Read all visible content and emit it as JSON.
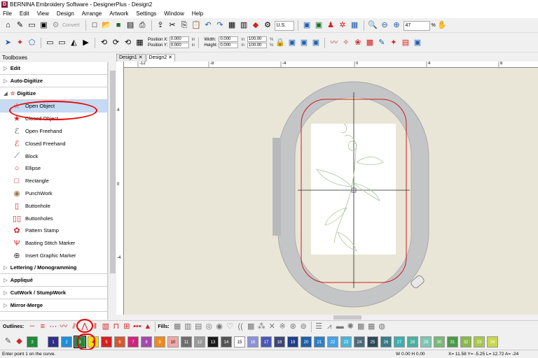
{
  "title": "BERNINA Embroidery Software - DesignerPlus - Design2",
  "menu": [
    "File",
    "Edit",
    "View",
    "Design",
    "Arrange",
    "Artwork",
    "Settings",
    "Window",
    "Help"
  ],
  "toolbar": {
    "convert_label": "Convert",
    "units": "U.S.",
    "zoom": "47",
    "zoom_unit": "%"
  },
  "position": {
    "x_label": "Position X:",
    "y_label": "Position Y:",
    "x_value": "0.000",
    "y_value": "0.000",
    "width_label": "Width:",
    "height_label": "Height:",
    "width_value": "0.000",
    "height_value": "0.000",
    "width_pct": "100.00",
    "height_pct": "100.00",
    "unit": "in",
    "pct_unit": "%"
  },
  "toolboxes_label": "Toolboxes",
  "sections_top": [
    {
      "label": "Edit"
    },
    {
      "label": "Auto-Digitize"
    }
  ],
  "digitize": {
    "label": "Digitize",
    "items": [
      {
        "label": "Open Object",
        "icon": "open-object-icon"
      },
      {
        "label": "Closed Object",
        "icon": "closed-object-icon"
      },
      {
        "label": "Open Freehand",
        "icon": "open-freehand-icon"
      },
      {
        "label": "Closed Freehand",
        "icon": "closed-freehand-icon"
      },
      {
        "label": "Block",
        "icon": "block-icon"
      },
      {
        "label": "Ellipse",
        "icon": "ellipse-icon"
      },
      {
        "label": "Rectangle",
        "icon": "rectangle-icon"
      },
      {
        "label": "PunchWork",
        "icon": "punchwork-icon"
      },
      {
        "label": "Buttonhole",
        "icon": "buttonhole-icon"
      },
      {
        "label": "Buttonholes",
        "icon": "buttonholes-icon"
      },
      {
        "label": "Pattern Stamp",
        "icon": "pattern-stamp-icon"
      },
      {
        "label": "Basting Stitch Marker",
        "icon": "basting-marker-icon"
      },
      {
        "label": "Insert Graphic Marker",
        "icon": "graphic-marker-icon"
      }
    ]
  },
  "sections_bottom": [
    {
      "label": "Lettering / Monogramming"
    },
    {
      "label": "Appliqué"
    },
    {
      "label": "CutWork / StumpWork"
    },
    {
      "label": "Mirror-Merge"
    }
  ],
  "tabs": [
    {
      "label": "Design1"
    },
    {
      "label": "Design2"
    }
  ],
  "ruler": {
    "top": [
      "-12",
      "-8",
      "-4",
      "0",
      "4",
      "8"
    ],
    "left": [
      "4",
      "0",
      "-4"
    ]
  },
  "outlines_label": "Outlines:",
  "fills_label": "Fills:",
  "colors": [
    {
      "n": "3",
      "hex": "#1e8a3a"
    },
    {
      "n": "1",
      "hex": "#2e2e8a"
    },
    {
      "n": "2",
      "hex": "#1f8ed8"
    },
    {
      "n": "3",
      "hex": "#1e8a3a"
    },
    {
      "n": "4",
      "hex": "#f4e000"
    },
    {
      "n": "5",
      "hex": "#d62020"
    },
    {
      "n": "6",
      "hex": "#d25830"
    },
    {
      "n": "7",
      "hex": "#d1247d"
    },
    {
      "n": "8",
      "hex": "#a44aa8"
    },
    {
      "n": "9",
      "hex": "#ee8a1c"
    },
    {
      "n": "10",
      "hex": "#f3a7a7"
    },
    {
      "n": "11",
      "hex": "#6e6e6e"
    },
    {
      "n": "12",
      "hex": "#9a9a9a"
    },
    {
      "n": "13",
      "hex": "#1a1a1a"
    },
    {
      "n": "14",
      "hex": "#555555"
    },
    {
      "n": "15",
      "hex": "#ffffff"
    },
    {
      "n": "16",
      "hex": "#8b93d8"
    },
    {
      "n": "17",
      "hex": "#4a58b8"
    },
    {
      "n": "18",
      "hex": "#3c4678"
    },
    {
      "n": "19",
      "hex": "#1f3e8c"
    },
    {
      "n": "20",
      "hex": "#1e5fa8"
    },
    {
      "n": "21",
      "hex": "#2a7fc8"
    },
    {
      "n": "22",
      "hex": "#45a2e8"
    },
    {
      "n": "23",
      "hex": "#4ab4d8"
    },
    {
      "n": "24",
      "hex": "#4e6a7c"
    },
    {
      "n": "25",
      "hex": "#2e4a58"
    },
    {
      "n": "26",
      "hex": "#3a7a88"
    },
    {
      "n": "27",
      "hex": "#3ab0b0"
    },
    {
      "n": "28",
      "hex": "#4ab0a0"
    },
    {
      "n": "29",
      "hex": "#7cc8b4"
    },
    {
      "n": "30",
      "hex": "#7ab87a"
    },
    {
      "n": "31",
      "hex": "#4a9a4a"
    },
    {
      "n": "32",
      "hex": "#8ab84a"
    },
    {
      "n": "33",
      "hex": "#a8c84a"
    },
    {
      "n": "34",
      "hex": "#c8d84a"
    }
  ],
  "status": {
    "left": "Enter point 1 on the curve.",
    "wh": "W 0.00  H 0.00",
    "coords": "X= 11.58 Y= -5.25 L= 12.72 A= -24"
  },
  "accent": "#d62020",
  "selection": "#c5daf3"
}
